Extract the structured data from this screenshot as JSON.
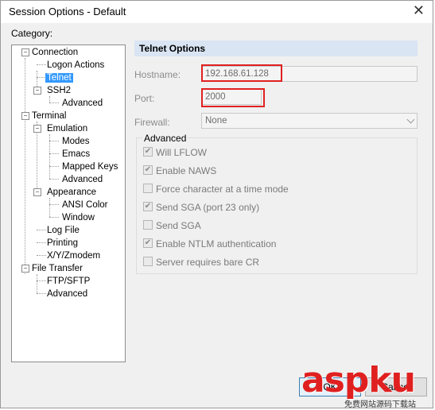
{
  "window": {
    "title": "Session Options - Default"
  },
  "category_label": "Category:",
  "tree": {
    "items": [
      {
        "label": "Connection"
      },
      {
        "label": "Logon Actions"
      },
      {
        "label": "Telnet"
      },
      {
        "label": "SSH2"
      },
      {
        "label": "Advanced"
      },
      {
        "label": "Terminal"
      },
      {
        "label": "Emulation"
      },
      {
        "label": "Modes"
      },
      {
        "label": "Emacs"
      },
      {
        "label": "Mapped Keys"
      },
      {
        "label": "Advanced"
      },
      {
        "label": "Appearance"
      },
      {
        "label": "ANSI Color"
      },
      {
        "label": "Window"
      },
      {
        "label": "Log File"
      },
      {
        "label": "Printing"
      },
      {
        "label": "X/Y/Zmodem"
      },
      {
        "label": "File Transfer"
      },
      {
        "label": "FTP/SFTP"
      },
      {
        "label": "Advanced"
      }
    ],
    "selected": "Telnet"
  },
  "panel": {
    "header": "Telnet Options",
    "hostname_label": "Hostname:",
    "hostname_value": "192.168.61.128",
    "port_label": "Port:",
    "port_value": "2000",
    "firewall_label": "Firewall:",
    "firewall_value": "None",
    "advanced_title": "Advanced",
    "checks": [
      {
        "label": "Will LFLOW",
        "checked": true
      },
      {
        "label": "Enable NAWS",
        "checked": true
      },
      {
        "label": "Force character at a time mode",
        "checked": false
      },
      {
        "label": "Send SGA (port 23 only)",
        "checked": true
      },
      {
        "label": "Send SGA",
        "checked": false
      },
      {
        "label": "Enable NTLM authentication",
        "checked": true
      },
      {
        "label": "Server requires bare CR",
        "checked": false
      }
    ]
  },
  "buttons": {
    "ok": "OK",
    "cancel": "Cancel"
  },
  "watermark": {
    "text": "aspku",
    "sub": "免费网站源码下载站"
  },
  "colors": {
    "highlight": "#e02020",
    "selection": "#3399ff",
    "header_bg": "#d9e5f3"
  }
}
